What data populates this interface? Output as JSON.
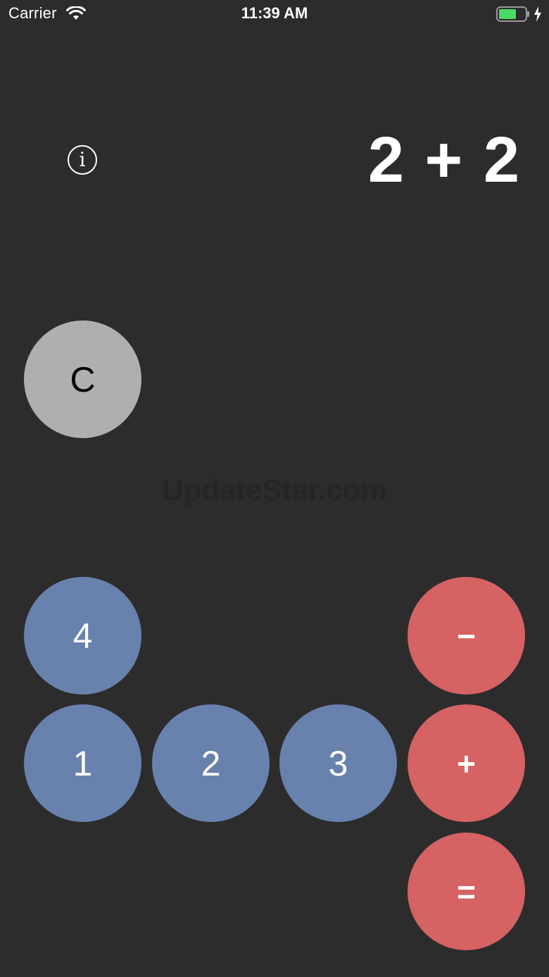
{
  "status_bar": {
    "carrier": "Carrier",
    "time": "11:39 AM",
    "wifi_icon": "wifi-icon",
    "battery_icon": "battery-charging-icon",
    "battery_color": "#4cd964"
  },
  "calculator": {
    "info_icon": "info-icon",
    "info_label": "i",
    "display": "2 + 2",
    "watermark": "UpdateStar.com",
    "keys": {
      "clear": "C",
      "four": "4",
      "one": "1",
      "two": "2",
      "three": "3",
      "minus": "−",
      "plus": "+",
      "equals": "="
    },
    "colors": {
      "background": "#2c2c2c",
      "clear_key": "#afafaf",
      "digit_key": "#6882ad",
      "operator_key": "#d66263"
    }
  }
}
